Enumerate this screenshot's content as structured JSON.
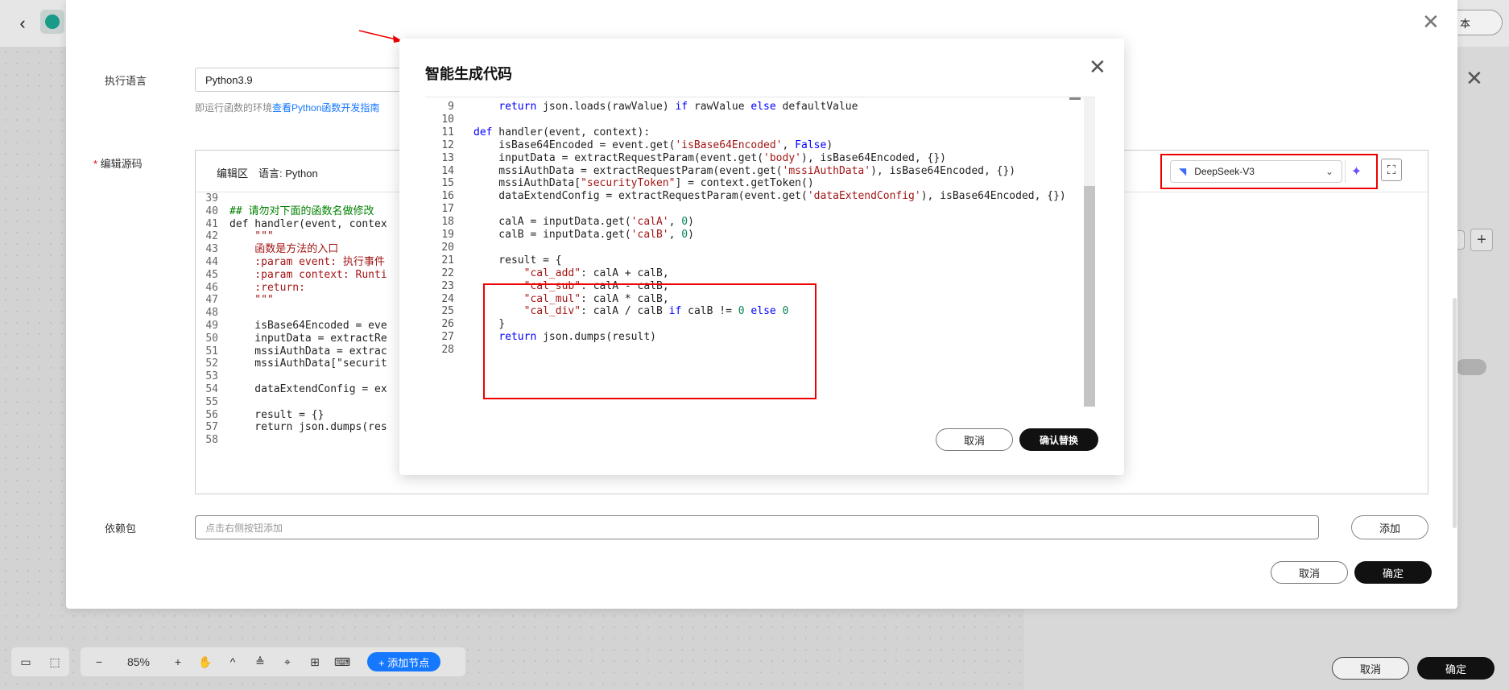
{
  "background": {
    "version_button": "本",
    "zoom": "85%",
    "add_node": "+ 添加节点",
    "cancel": "取消",
    "ok": "确定"
  },
  "main_dialog": {
    "exec_lang_label": "执行语言",
    "exec_lang_value": "Python3.9",
    "hint_prefix": "即运行函数的环境",
    "hint_link": "查看Python函数开发指南",
    "source_label": "编辑源码",
    "editor_tab": "编辑区",
    "language_label": "语言: Python",
    "model": "DeepSeek-V3",
    "deps_label": "依赖包",
    "deps_placeholder": "点击右侧按钮添加",
    "deps_add": "添加",
    "cancel": "取消",
    "ok": "确定",
    "code_lines": [
      {
        "n": "39",
        "t": ""
      },
      {
        "n": "40",
        "t": "## 请勿对下面的函数名做修改"
      },
      {
        "n": "41",
        "t": "def handler(event, contex"
      },
      {
        "n": "42",
        "t": "    \"\"\""
      },
      {
        "n": "43",
        "t": "    函数是方法的入口"
      },
      {
        "n": "44",
        "t": "    :param event: 执行事件"
      },
      {
        "n": "45",
        "t": "    :param context: Runti"
      },
      {
        "n": "46",
        "t": "    :return:"
      },
      {
        "n": "47",
        "t": "    \"\"\""
      },
      {
        "n": "48",
        "t": ""
      },
      {
        "n": "49",
        "t": "    isBase64Encoded = eve"
      },
      {
        "n": "50",
        "t": "    inputData = extractRe"
      },
      {
        "n": "51",
        "t": "    mssiAuthData = extrac"
      },
      {
        "n": "52",
        "t": "    mssiAuthData[\"securit"
      },
      {
        "n": "53",
        "t": ""
      },
      {
        "n": "54",
        "t": "    dataExtendConfig = ex"
      },
      {
        "n": "55",
        "t": ""
      },
      {
        "n": "56",
        "t": "    result = {}"
      },
      {
        "n": "57",
        "t": "    return json.dumps(res"
      },
      {
        "n": "58",
        "t": ""
      }
    ]
  },
  "ai_dialog": {
    "title": "智能生成代码",
    "cancel": "取消",
    "confirm": "确认替换",
    "code_lines": [
      {
        "n": "9",
        "h": "    <span class='kw'>return</span> json.loads(rawValue) <span class='kw'>if</span> rawValue <span class='kw'>else</span> defaultValue"
      },
      {
        "n": "10",
        "h": ""
      },
      {
        "n": "11",
        "h": "<span class='kw'>def</span> handler(event, context):"
      },
      {
        "n": "12",
        "h": "    isBase64Encoded = event.get(<span class='st'>'isBase64Encoded'</span>, <span class='kw'>False</span>)"
      },
      {
        "n": "13",
        "h": "    inputData = extractRequestParam(event.get(<span class='st'>'body'</span>), isBase64Encoded, {})"
      },
      {
        "n": "14",
        "h": "    mssiAuthData = extractRequestParam(event.get(<span class='st'>'mssiAuthData'</span>), isBase64Encoded, {})"
      },
      {
        "n": "15",
        "h": "    mssiAuthData[<span class='st'>\"securityToken\"</span>] = context.getToken()"
      },
      {
        "n": "16",
        "h": "    dataExtendConfig = extractRequestParam(event.get(<span class='st'>'dataExtendConfig'</span>), isBase64Encoded, {})"
      },
      {
        "n": "17",
        "h": ""
      },
      {
        "n": "18",
        "h": "    calA = inputData.get(<span class='st'>'calA'</span>, <span class='nm'>0</span>)"
      },
      {
        "n": "19",
        "h": "    calB = inputData.get(<span class='st'>'calB'</span>, <span class='nm'>0</span>)"
      },
      {
        "n": "20",
        "h": ""
      },
      {
        "n": "21",
        "h": "    result = {"
      },
      {
        "n": "22",
        "h": "        <span class='st'>\"cal_add\"</span>: calA + calB,"
      },
      {
        "n": "23",
        "h": "        <span class='st'>\"cal_sub\"</span>: calA - calB,"
      },
      {
        "n": "24",
        "h": "        <span class='st'>\"cal_mul\"</span>: calA * calB,"
      },
      {
        "n": "25",
        "h": "        <span class='st'>\"cal_div\"</span>: calA / calB <span class='kw'>if</span> calB != <span class='nm'>0</span> <span class='kw'>else</span> <span class='nm'>0</span>"
      },
      {
        "n": "26",
        "h": "    }"
      },
      {
        "n": "27",
        "h": "    <span class='kw'>return</span> json.dumps(result)"
      },
      {
        "n": "28",
        "h": ""
      }
    ]
  }
}
